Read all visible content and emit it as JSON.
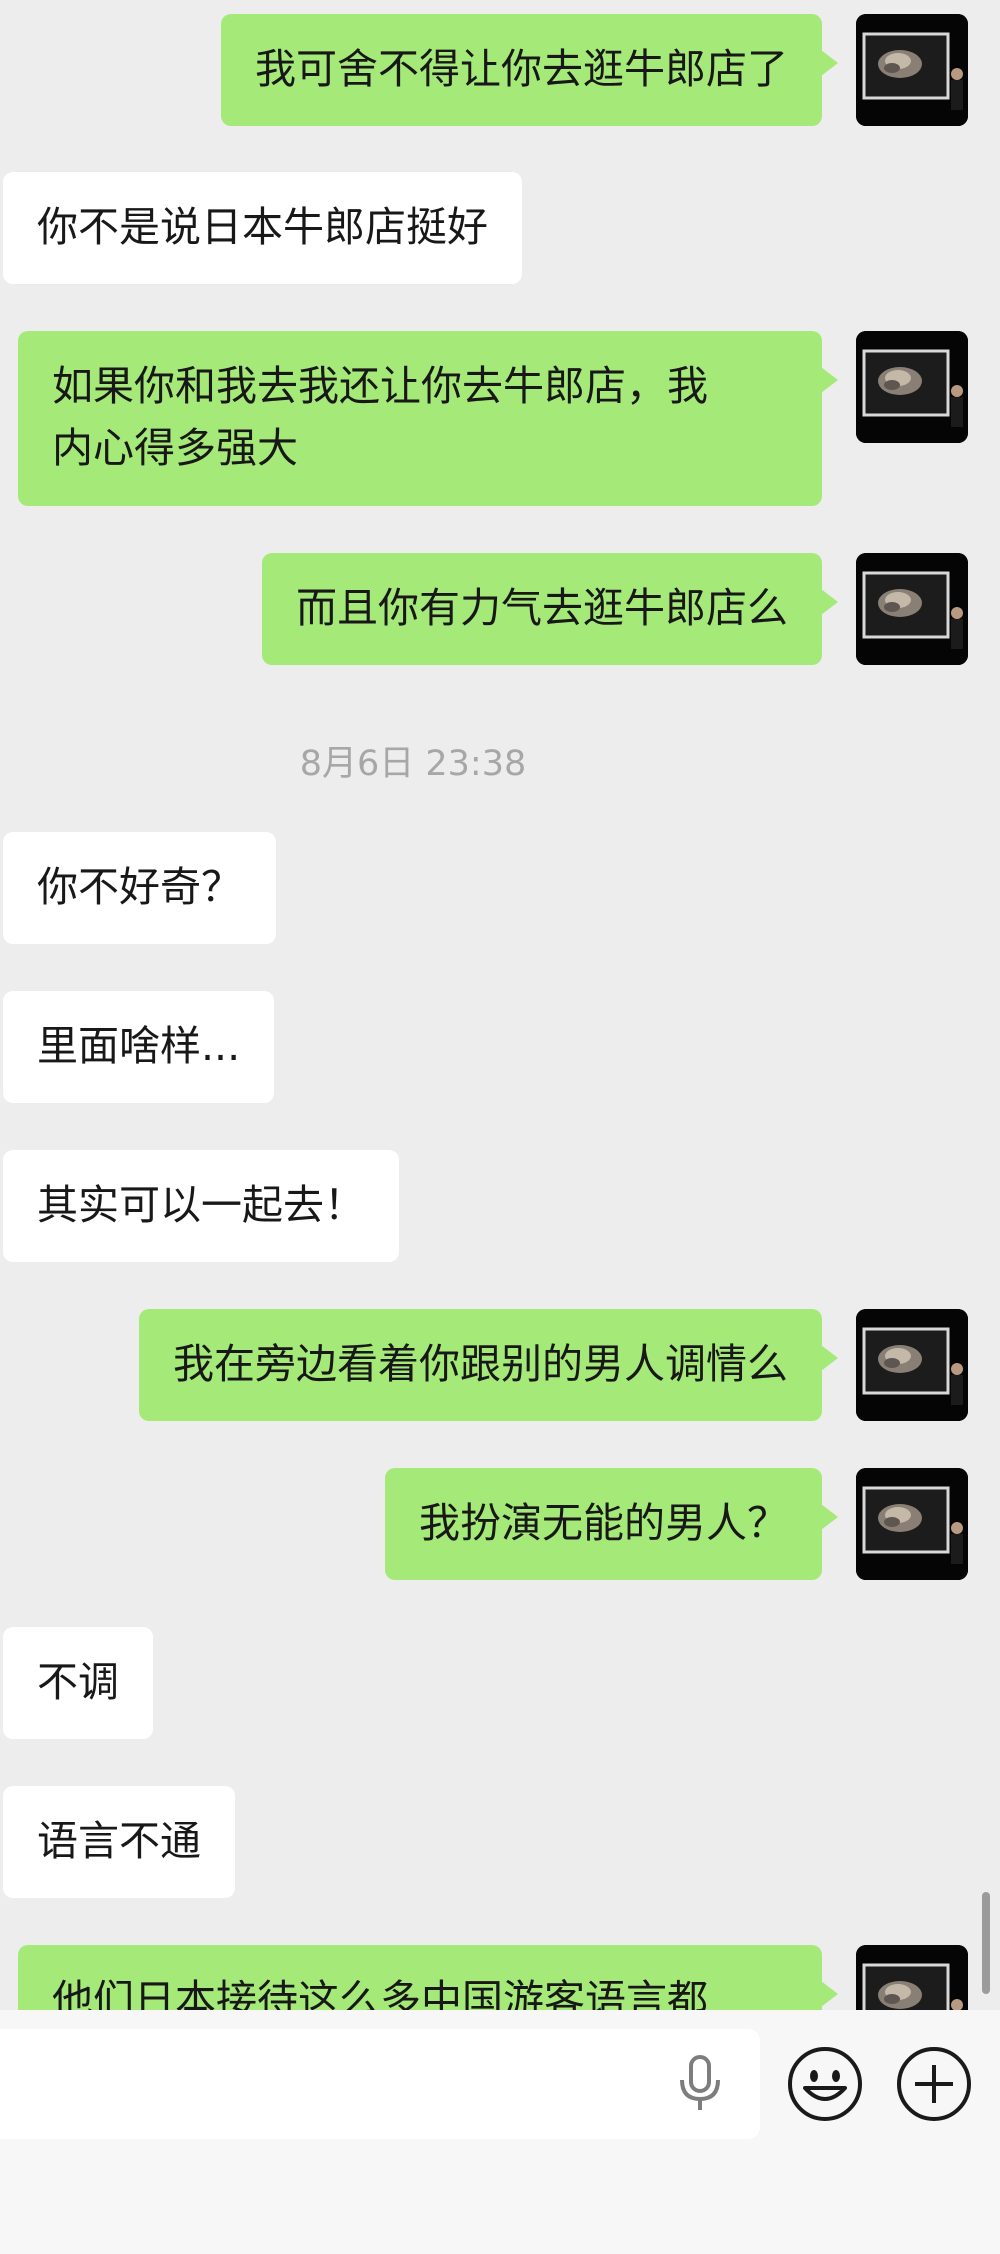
{
  "chat": {
    "messages": [
      {
        "side": "out",
        "text": "我可舍不得让你去逛牛郎店了"
      },
      {
        "side": "in",
        "text": "你不是说日本牛郎店挺好"
      },
      {
        "side": "out",
        "text": "如果你和我去我还让你去牛郎店，我\n内心得多强大"
      },
      {
        "side": "out",
        "text": "而且你有力气去逛牛郎店么"
      },
      {
        "side": "in",
        "text": "你不好奇？"
      },
      {
        "side": "in",
        "text": "里面啥样..."
      },
      {
        "side": "in",
        "text": "其实可以一起去！"
      },
      {
        "side": "out",
        "text": "我在旁边看着你跟别的男人调情么"
      },
      {
        "side": "out",
        "text": "我扮演无能的男人？"
      },
      {
        "side": "in",
        "text": "不调"
      },
      {
        "side": "in",
        "text": "语言不通"
      },
      {
        "side": "out",
        "text": "他们日本接待这么多中国游客语言都"
      }
    ],
    "timestamp": "8月6日 23:38"
  },
  "input_bar": {
    "input_value": "",
    "mic_icon": "microphone-icon",
    "emoji_icon": "smiley-face-icon",
    "plus_icon": "plus-circle-icon"
  },
  "colors": {
    "background": "#ededed",
    "incoming_bubble": "#ffffff",
    "outgoing_bubble": "#a5e978",
    "text": "#181818",
    "timestamp": "#a7a7a7"
  }
}
